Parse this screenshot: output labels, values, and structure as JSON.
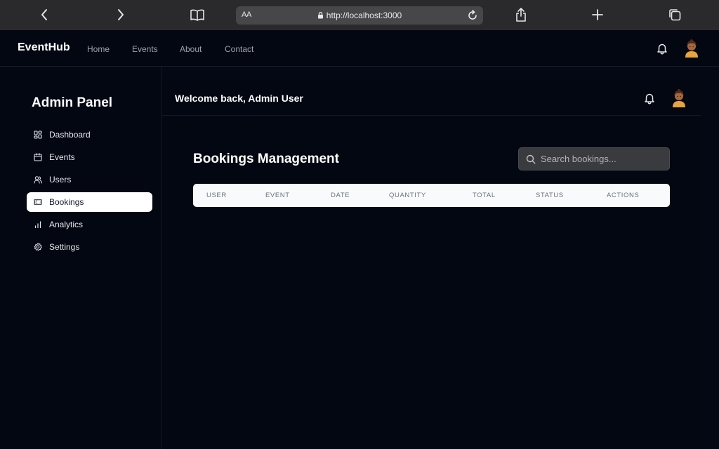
{
  "browser": {
    "aa_label": "AA",
    "url": "http://localhost:3000"
  },
  "header": {
    "brand": "EventHub",
    "nav": [
      "Home",
      "Events",
      "About",
      "Contact"
    ]
  },
  "sidebar": {
    "title": "Admin Panel",
    "items": [
      {
        "label": "Dashboard",
        "icon": "dashboard-icon"
      },
      {
        "label": "Events",
        "icon": "calendar-icon"
      },
      {
        "label": "Users",
        "icon": "users-icon"
      },
      {
        "label": "Bookings",
        "icon": "ticket-icon",
        "active": true
      },
      {
        "label": "Analytics",
        "icon": "bar-chart-icon"
      },
      {
        "label": "Settings",
        "icon": "gear-icon"
      }
    ]
  },
  "main": {
    "welcome": "Welcome back, Admin User",
    "section_title": "Bookings Management",
    "search_placeholder": "Search bookings...",
    "columns": [
      "USER",
      "EVENT",
      "DATE",
      "QUANTITY",
      "TOTAL",
      "STATUS",
      "ACTIONS"
    ]
  },
  "colors": {
    "background": "#040814",
    "active_item": "#ffffff",
    "table_header_bg": "#f9fafb"
  }
}
